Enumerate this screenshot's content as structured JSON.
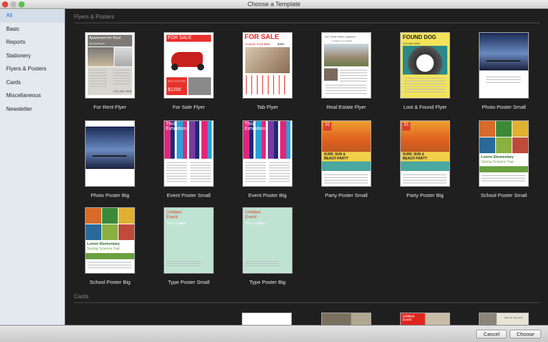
{
  "window": {
    "title": "Choose a Template"
  },
  "sidebar": {
    "items": [
      {
        "label": "All",
        "selected": true
      },
      {
        "label": "Basic"
      },
      {
        "label": "Reports"
      },
      {
        "label": "Stationery"
      },
      {
        "label": "Flyers & Posters"
      },
      {
        "label": "Cards"
      },
      {
        "label": "Miscellaneous"
      },
      {
        "label": "Newsletter"
      }
    ]
  },
  "sections": {
    "flyers": "Flyers & Posters",
    "cards": "Cards"
  },
  "templates": [
    {
      "label": "For Rent Flyer",
      "kind": "rent",
      "t1": "Apartment for Rent",
      "t2": "$1400/Month",
      "t3": "123.456.7890"
    },
    {
      "label": "For Sale Flyer",
      "kind": "sale",
      "t1": "FOR SALE",
      "t2": "RED SCOOTER",
      "t3": "$1200"
    },
    {
      "label": "Tab Flyer",
      "kind": "tab",
      "t1": "FOR SALE",
      "t2": "Custom Fixie Bike",
      "t3": "$300"
    },
    {
      "label": "Real Estate Flyer",
      "kind": "estate",
      "t1": "4321 Real Street, Anytown",
      "t2": "Contact us for details"
    },
    {
      "label": "Lost & Found Flyer",
      "kind": "dog",
      "t1": "FOUND DOG",
      "t2": "123-456-7890"
    },
    {
      "label": "Photo Poster Small",
      "kind": "photo"
    },
    {
      "label": "Photo Poster Big",
      "kind": "photobig"
    },
    {
      "label": "Event Poster Small",
      "kind": "event",
      "t1": "This",
      "t2": "Exhibition"
    },
    {
      "label": "Event Poster Big",
      "kind": "event",
      "t1": "This",
      "t2": "Exhibition"
    },
    {
      "label": "Party Poster Small",
      "kind": "party",
      "t1": "31",
      "t2": "SURF, SUN &",
      "t3": "BEACH PARTY"
    },
    {
      "label": "Party Poster Big",
      "kind": "party",
      "t1": "31",
      "t2": "SURF, SUN &",
      "t3": "BEACH PARTY"
    },
    {
      "label": "School Poster Small",
      "kind": "school",
      "t1": "Lorem Elementary",
      "t2": "Spring Science Fair"
    },
    {
      "label": "School Poster Big",
      "kind": "school",
      "t1": "Lorem Elementary",
      "t2": "Spring Science Fair"
    },
    {
      "label": "Type Poster Small",
      "kind": "type",
      "t1": "Untitled",
      "t2": "Event",
      "t3": "The Location"
    },
    {
      "label": "Type Poster Big",
      "kind": "type",
      "t1": "Untitled",
      "t2": "Event",
      "t3": "The Location"
    }
  ],
  "cards": [
    {
      "kind": "blank"
    },
    {
      "kind": "house"
    },
    {
      "kind": "event",
      "t1": "Untitled Event"
    },
    {
      "kind": "moved",
      "t1": "We've Moved"
    }
  ],
  "buttons": {
    "cancel": "Cancel",
    "choose": "Choose"
  }
}
